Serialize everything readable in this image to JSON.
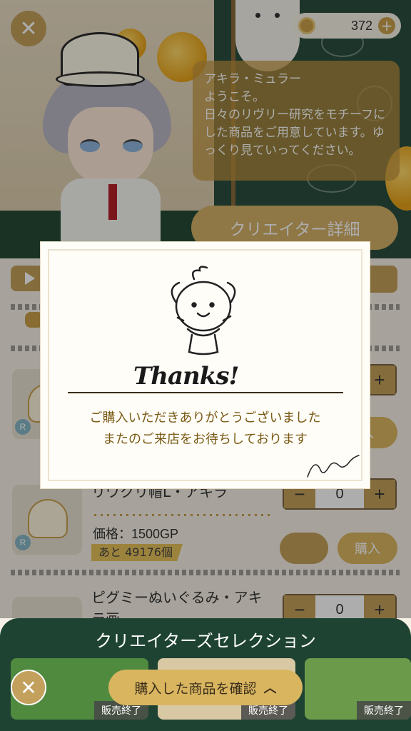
{
  "header": {
    "coin_balance": "372",
    "greeting_name": "アキラ・ミュラー",
    "greeting_body": "ようこそ。\n日々のリヴリー研究をモチーフにした商品をご用意しています。ゆっくり見ていってください。",
    "creator_detail_label": "クリエイター詳細"
  },
  "list": {
    "sort_label": "V",
    "items": [
      {
        "name": "",
        "badge": "R",
        "buy_label": "入",
        "quantity": ""
      },
      {
        "name": "リワクリ帽L・アキラ",
        "badge": "R",
        "price": "価格：1500GP",
        "stock": "あと 49176個",
        "quantity": "0",
        "buy_label": "購入"
      },
      {
        "name": "ピグミーぬいぐるみ・アキラ画",
        "quantity": "0"
      }
    ]
  },
  "modal": {
    "thanks_text": "Thanks!",
    "message_line1": "ご購入いただきありがとうございました",
    "message_line2": "またのご来店をお待ちしております"
  },
  "creators": {
    "title": "クリエイターズセレクション",
    "banners": [
      {
        "sold_label": "販売終了",
        "color": "#4f8a3f"
      },
      {
        "sold_label": "販売終了",
        "color": "#d8c9a4"
      },
      {
        "sold_label": "販売終了",
        "color": "#6b9b4a"
      }
    ],
    "confirm_label": "購入した商品を確認"
  },
  "colors": {
    "accent_gold": "#c3a05b",
    "dark_green": "#1e4332",
    "message_brown": "#7a5a14"
  },
  "icons": {
    "close": "close-icon",
    "coin": "coin-icon",
    "plus": "plus-icon",
    "play": "play-icon",
    "cart": "cart-icon",
    "chevron_up": "chevron-up-icon"
  }
}
